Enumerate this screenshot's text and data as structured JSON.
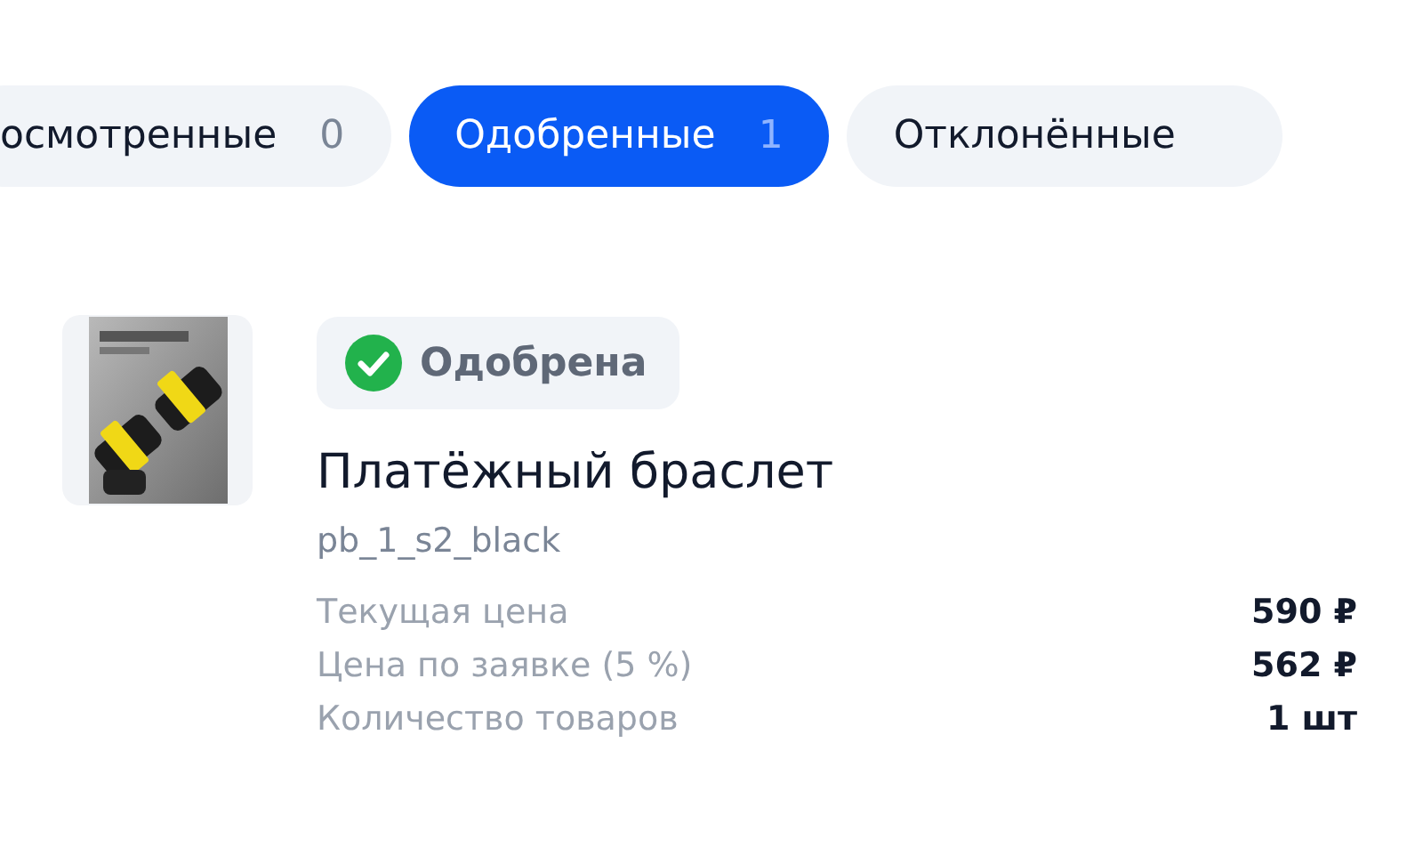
{
  "tabs": [
    {
      "label": "осмотренные",
      "count": "0",
      "selected": false
    },
    {
      "label": "Одобренные",
      "count": "1",
      "selected": true
    },
    {
      "label": "Отклонённые",
      "selected": false
    }
  ],
  "order": {
    "status": {
      "label": "Одобрена",
      "kind": "approved"
    },
    "title": "Платёжный браслет",
    "sku": "pb_1_s2_black",
    "details": [
      {
        "label": "Текущая цена",
        "value": "590 ₽"
      },
      {
        "label": "Цена по заявке (5 %)",
        "value": "562 ₽"
      },
      {
        "label": "Количество товаров",
        "value": "1 шт"
      }
    ]
  }
}
